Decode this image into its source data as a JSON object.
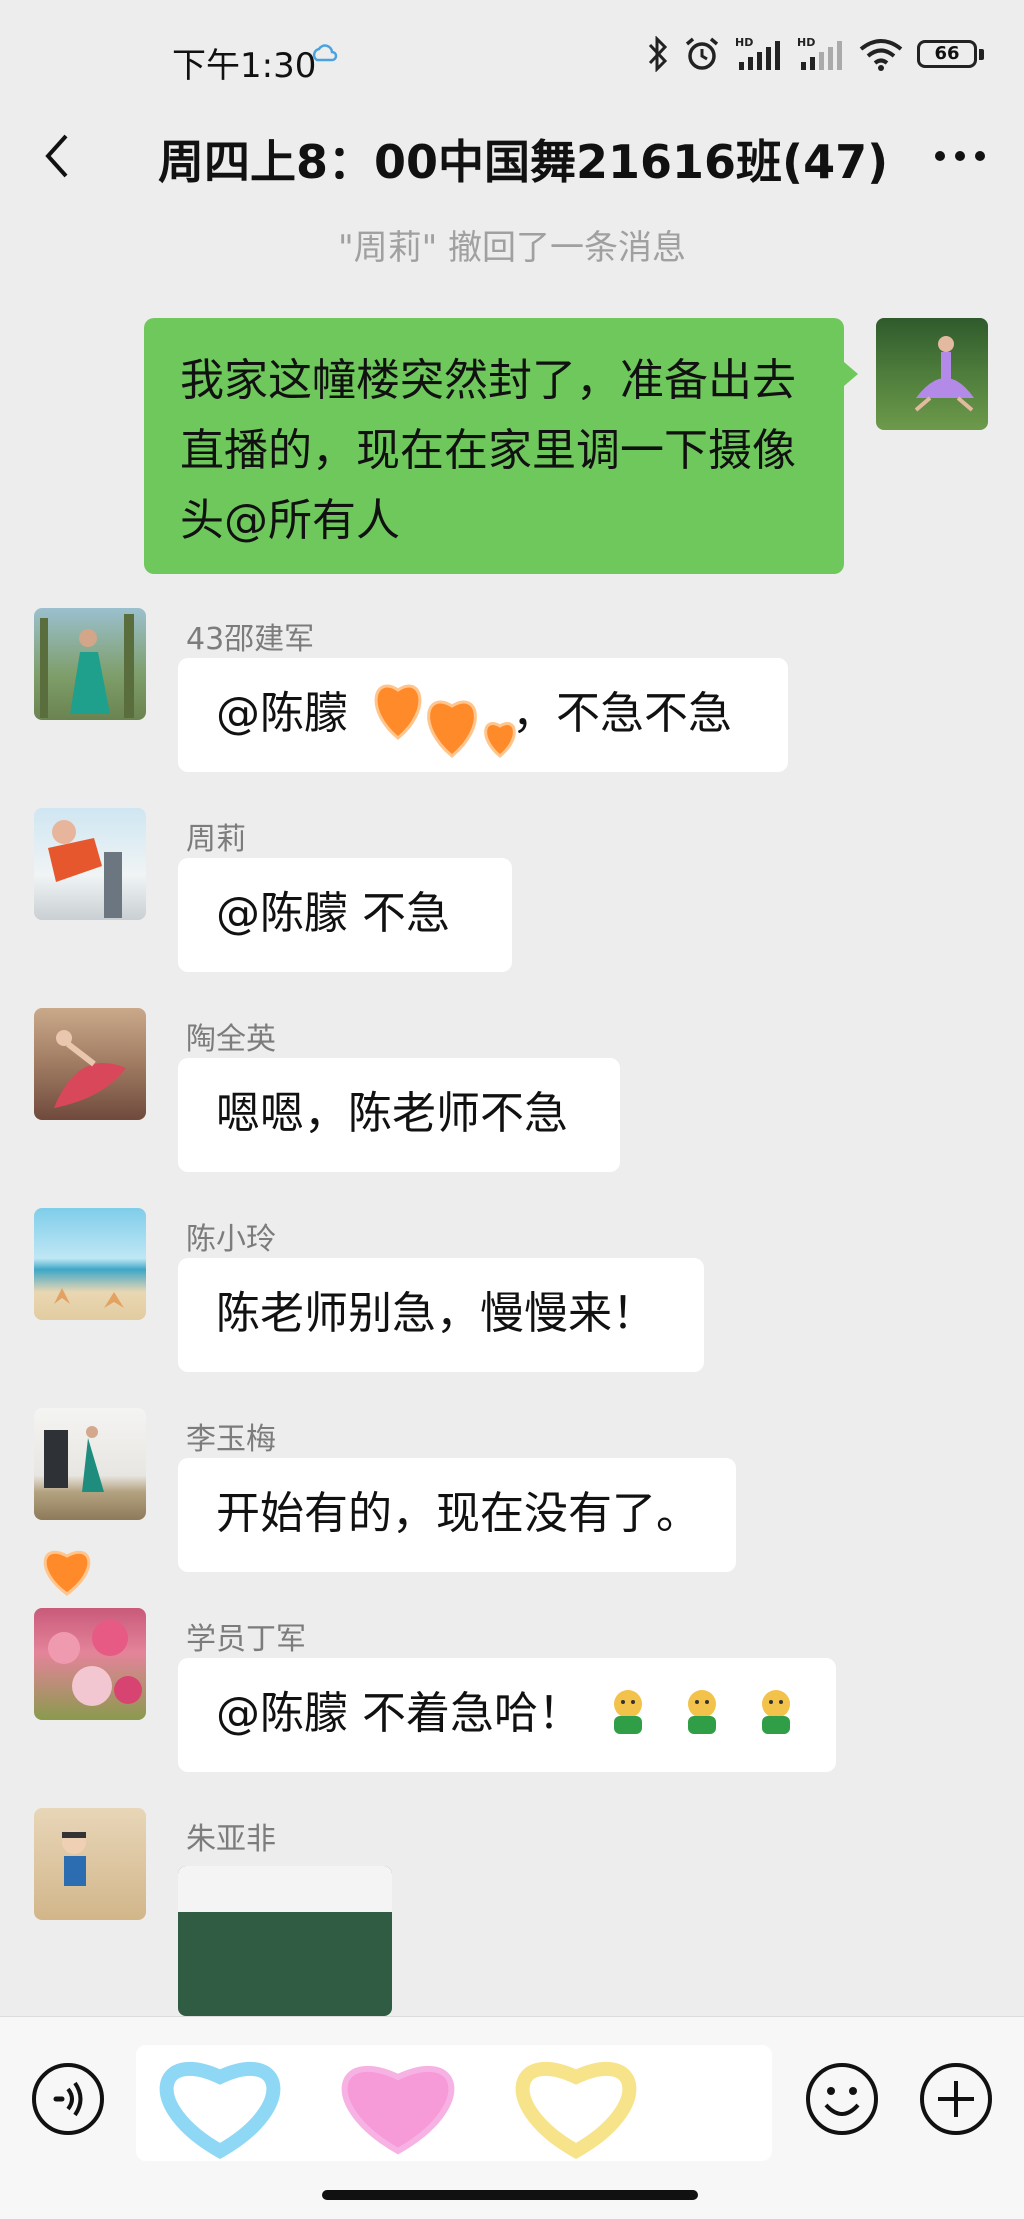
{
  "status_bar": {
    "time": "下午1:30",
    "battery": "66"
  },
  "nav": {
    "title": "周四上8：00中国舞21616班(47)"
  },
  "system_message": "\"周莉\" 撤回了一条消息",
  "messages": [
    {
      "sender": "",
      "text": "我家这幢楼突然封了，准备出去直播的，现在在家里调一下摄像头@所有人",
      "mine": true
    },
    {
      "sender": "43邵建军",
      "text_before": "@陈朦 ",
      "text_after": "，不急不急"
    },
    {
      "sender": "周莉",
      "text": "@陈朦  不急"
    },
    {
      "sender": "陶全英",
      "text": "嗯嗯，陈老师不急"
    },
    {
      "sender": "陈小玲",
      "text": "陈老师别急，慢慢来！"
    },
    {
      "sender": "李玉梅",
      "text": "开始有的，现在没有了。"
    },
    {
      "sender": "学员丁军",
      "text": "@陈朦  不着急哈！"
    },
    {
      "sender": "朱亚非",
      "type": "image"
    }
  ],
  "colors": {
    "background": "#ededed",
    "my_bubble": "#6fc85c",
    "other_bubble": "#ffffff",
    "heart_orange": "#ff8a2a",
    "heart_blue": "#8fd8f5",
    "heart_pink": "#f79ad8",
    "heart_yellow": "#f7e38a"
  },
  "icons": [
    "back-icon",
    "more-icon",
    "bluetooth-icon",
    "alarm-icon",
    "signal-icon",
    "wifi-icon",
    "battery-icon",
    "voice-icon",
    "emoji-icon",
    "plus-icon",
    "heart-icon"
  ]
}
